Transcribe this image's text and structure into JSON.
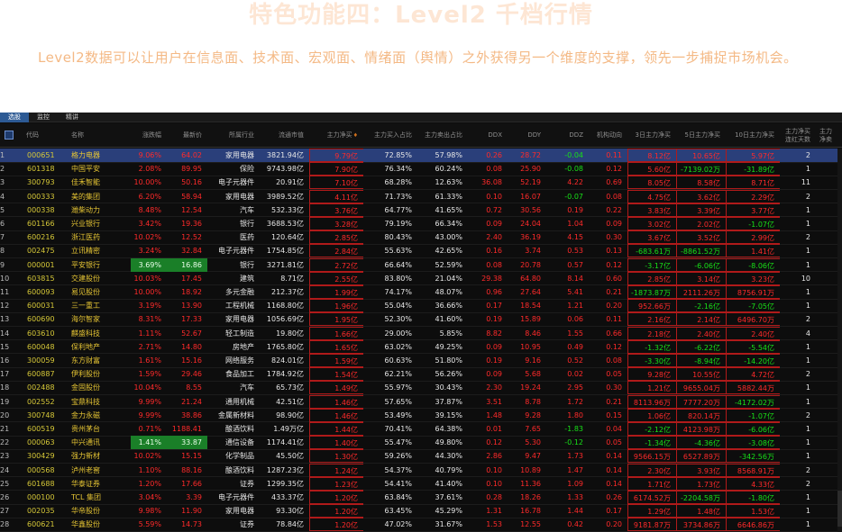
{
  "hero": {
    "title": "特色功能四：Level2 千档行情",
    "description": "Level2数据可以让用户在信息面、技术面、宏观面、情绪面（舆情）之外获得另一个维度的支撑，领先一步捕捉市场机会。"
  },
  "tabs": [
    "选股",
    "监控",
    "精讲"
  ],
  "columns": [
    "代码",
    "名称",
    "涨跌幅",
    "最新价",
    "所属行业",
    "流通市值",
    "主力净买",
    "主力买入占比",
    "主力卖出占比",
    "DDX",
    "DDY",
    "DDZ",
    "机构动向",
    "3日主力净买",
    "5日主力净买",
    "10日主力净买",
    "主力净买连红天数",
    "主力净卖"
  ],
  "colors": {
    "up": "#ff2a2a",
    "down": "#18e018",
    "selected": "#2a3f7a",
    "code": "#d6c838"
  },
  "rows": [
    {
      "idx": "1",
      "code": "000651",
      "name": "格力电器",
      "chg": "9.06%",
      "price": "64.02",
      "industry": "家用电器",
      "mcap": "3821.94亿",
      "net": "9.79亿",
      "buy": "72.85%",
      "sell": "57.98%",
      "ddx": "0.26",
      "ddy": "28.72",
      "ddz": "-0.04",
      "inst": "0.11",
      "d3": "8.12亿",
      "d5": "10.65亿",
      "d10": "5.97亿",
      "days": "2"
    },
    {
      "idx": "2",
      "code": "601318",
      "name": "中国平安",
      "chg": "2.08%",
      "price": "89.95",
      "industry": "保险",
      "mcap": "9743.98亿",
      "net": "7.90亿",
      "buy": "76.34%",
      "sell": "60.24%",
      "ddx": "0.08",
      "ddy": "25.90",
      "ddz": "-0.08",
      "inst": "0.12",
      "d3": "5.60亿",
      "d5": "-7139.02万",
      "d10": "-31.89亿",
      "days": "1"
    },
    {
      "idx": "3",
      "code": "300793",
      "name": "佳禾智能",
      "chg": "10.00%",
      "price": "50.16",
      "industry": "电子元器件",
      "mcap": "20.91亿",
      "net": "7.10亿",
      "buy": "68.28%",
      "sell": "12.63%",
      "ddx": "36.08",
      "ddy": "52.19",
      "ddz": "4.22",
      "inst": "0.69",
      "d3": "8.05亿",
      "d5": "8.58亿",
      "d10": "8.71亿",
      "days": "11"
    },
    {
      "idx": "4",
      "code": "000333",
      "name": "美的集团",
      "chg": "6.20%",
      "price": "58.94",
      "industry": "家用电器",
      "mcap": "3989.52亿",
      "net": "4.11亿",
      "buy": "71.73%",
      "sell": "61.33%",
      "ddx": "0.10",
      "ddy": "16.07",
      "ddz": "-0.07",
      "inst": "0.08",
      "d3": "4.75亿",
      "d5": "3.62亿",
      "d10": "2.29亿",
      "days": "2"
    },
    {
      "idx": "5",
      "code": "000338",
      "name": "潍柴动力",
      "chg": "8.48%",
      "price": "12.54",
      "industry": "汽车",
      "mcap": "532.33亿",
      "net": "3.76亿",
      "buy": "64.77%",
      "sell": "41.65%",
      "ddx": "0.72",
      "ddy": "30.56",
      "ddz": "0.19",
      "inst": "0.22",
      "d3": "3.83亿",
      "d5": "3.39亿",
      "d10": "3.77亿",
      "days": "1"
    },
    {
      "idx": "6",
      "code": "601166",
      "name": "兴业银行",
      "chg": "3.42%",
      "price": "19.36",
      "industry": "银行",
      "mcap": "3688.53亿",
      "net": "3.28亿",
      "buy": "79.19%",
      "sell": "66.34%",
      "ddx": "0.09",
      "ddy": "24.04",
      "ddz": "1.04",
      "inst": "0.09",
      "d3": "3.02亿",
      "d5": "2.02亿",
      "d10": "-1.07亿",
      "days": "1"
    },
    {
      "idx": "7",
      "code": "600216",
      "name": "浙江医药",
      "chg": "10.02%",
      "price": "12.52",
      "industry": "医药",
      "mcap": "120.64亿",
      "net": "2.85亿",
      "buy": "80.43%",
      "sell": "43.00%",
      "ddx": "2.40",
      "ddy": "36.19",
      "ddz": "4.15",
      "inst": "0.30",
      "d3": "3.67亿",
      "d5": "3.52亿",
      "d10": "2.99亿",
      "days": "2"
    },
    {
      "idx": "8",
      "code": "002475",
      "name": "立讯精密",
      "chg": "3.24%",
      "price": "32.84",
      "industry": "电子元器件",
      "mcap": "1754.85亿",
      "net": "2.84亿",
      "buy": "55.63%",
      "sell": "42.65%",
      "ddx": "0.16",
      "ddy": "3.74",
      "ddz": "0.53",
      "inst": "0.13",
      "d3": "-683.61万",
      "d5": "-8861.52万",
      "d10": "1.41亿",
      "days": "1"
    },
    {
      "idx": "9",
      "code": "000001",
      "name": "平安银行",
      "chg": "3.69%",
      "price": "16.86",
      "industry": "银行",
      "mcap": "3271.81亿",
      "net": "2.72亿",
      "buy": "66.64%",
      "sell": "52.59%",
      "ddx": "0.08",
      "ddy": "20.78",
      "ddz": "0.57",
      "inst": "0.12",
      "d3": "-3.17亿",
      "d5": "-6.06亿",
      "d10": "-8.06亿",
      "days": "1"
    },
    {
      "idx": "10",
      "code": "603815",
      "name": "交建股份",
      "chg": "10.03%",
      "price": "17.45",
      "industry": "建筑",
      "mcap": "8.71亿",
      "net": "2.55亿",
      "buy": "83.80%",
      "sell": "21.04%",
      "ddx": "29.38",
      "ddy": "64.80",
      "ddz": "8.14",
      "inst": "0.60",
      "d3": "2.85亿",
      "d5": "3.14亿",
      "d10": "3.23亿",
      "days": "10"
    },
    {
      "idx": "11",
      "code": "600093",
      "name": "易见股份",
      "chg": "10.00%",
      "price": "18.92",
      "industry": "多元金融",
      "mcap": "212.37亿",
      "net": "1.99亿",
      "buy": "74.17%",
      "sell": "48.07%",
      "ddx": "0.96",
      "ddy": "27.64",
      "ddz": "5.41",
      "inst": "0.21",
      "d3": "-1873.87万",
      "d5": "2111.26万",
      "d10": "8756.91万",
      "days": "1"
    },
    {
      "idx": "12",
      "code": "600031",
      "name": "三一重工",
      "chg": "3.19%",
      "price": "13.90",
      "industry": "工程机械",
      "mcap": "1168.80亿",
      "net": "1.96亿",
      "buy": "55.04%",
      "sell": "36.66%",
      "ddx": "0.17",
      "ddy": "18.54",
      "ddz": "1.21",
      "inst": "0.20",
      "d3": "952.66万",
      "d5": "-2.16亿",
      "d10": "-7.05亿",
      "days": "1"
    },
    {
      "idx": "13",
      "code": "600690",
      "name": "海尔智家",
      "chg": "8.31%",
      "price": "17.33",
      "industry": "家用电器",
      "mcap": "1056.69亿",
      "net": "1.95亿",
      "buy": "52.30%",
      "sell": "41.60%",
      "ddx": "0.19",
      "ddy": "15.89",
      "ddz": "0.06",
      "inst": "0.11",
      "d3": "2.16亿",
      "d5": "2.14亿",
      "d10": "6496.70万",
      "days": "2"
    },
    {
      "idx": "14",
      "code": "603610",
      "name": "麒盛科技",
      "chg": "1.11%",
      "price": "52.67",
      "industry": "轻工制造",
      "mcap": "19.80亿",
      "net": "1.66亿",
      "buy": "29.00%",
      "sell": "5.85%",
      "ddx": "8.82",
      "ddy": "8.46",
      "ddz": "1.55",
      "inst": "0.66",
      "d3": "2.18亿",
      "d5": "2.40亿",
      "d10": "2.40亿",
      "days": "4"
    },
    {
      "idx": "15",
      "code": "600048",
      "name": "保利地产",
      "chg": "2.71%",
      "price": "14.80",
      "industry": "房地产",
      "mcap": "1765.80亿",
      "net": "1.65亿",
      "buy": "63.02%",
      "sell": "49.25%",
      "ddx": "0.09",
      "ddy": "10.95",
      "ddz": "0.49",
      "inst": "0.12",
      "d3": "-1.32亿",
      "d5": "-6.22亿",
      "d10": "-5.54亿",
      "days": "1"
    },
    {
      "idx": "16",
      "code": "300059",
      "name": "东方财富",
      "chg": "1.61%",
      "price": "15.16",
      "industry": "网络服务",
      "mcap": "824.01亿",
      "net": "1.59亿",
      "buy": "60.63%",
      "sell": "51.80%",
      "ddx": "0.19",
      "ddy": "9.16",
      "ddz": "0.52",
      "inst": "0.08",
      "d3": "-3.30亿",
      "d5": "-8.94亿",
      "d10": "-14.20亿",
      "days": "1"
    },
    {
      "idx": "17",
      "code": "600887",
      "name": "伊利股份",
      "chg": "1.59%",
      "price": "29.46",
      "industry": "食品加工",
      "mcap": "1784.92亿",
      "net": "1.54亿",
      "buy": "62.21%",
      "sell": "56.26%",
      "ddx": "0.09",
      "ddy": "5.68",
      "ddz": "0.02",
      "inst": "0.05",
      "d3": "9.28亿",
      "d5": "10.55亿",
      "d10": "4.72亿",
      "days": "2"
    },
    {
      "idx": "18",
      "code": "002488",
      "name": "金固股份",
      "chg": "10.04%",
      "price": "8.55",
      "industry": "汽车",
      "mcap": "65.73亿",
      "net": "1.49亿",
      "buy": "55.97%",
      "sell": "30.43%",
      "ddx": "2.30",
      "ddy": "19.24",
      "ddz": "2.95",
      "inst": "0.30",
      "d3": "1.21亿",
      "d5": "9655.04万",
      "d10": "5882.44万",
      "days": "1"
    },
    {
      "idx": "19",
      "code": "002552",
      "name": "宝鼎科技",
      "chg": "9.99%",
      "price": "21.24",
      "industry": "通用机械",
      "mcap": "42.51亿",
      "net": "1.46亿",
      "buy": "57.65%",
      "sell": "37.87%",
      "ddx": "3.51",
      "ddy": "8.78",
      "ddz": "1.72",
      "inst": "0.21",
      "d3": "8113.96万",
      "d5": "7777.20万",
      "d10": "-4172.02万",
      "days": "1"
    },
    {
      "idx": "20",
      "code": "300748",
      "name": "金力永磁",
      "chg": "9.99%",
      "price": "38.86",
      "industry": "金属新材料",
      "mcap": "98.90亿",
      "net": "1.46亿",
      "buy": "53.49%",
      "sell": "39.15%",
      "ddx": "1.48",
      "ddy": "9.28",
      "ddz": "1.80",
      "inst": "0.15",
      "d3": "1.06亿",
      "d5": "820.14万",
      "d10": "-1.07亿",
      "days": "2"
    },
    {
      "idx": "21",
      "code": "600519",
      "name": "贵州茅台",
      "chg": "0.71%",
      "price": "1188.41",
      "industry": "酿酒饮料",
      "mcap": "1.49万亿",
      "net": "1.44亿",
      "buy": "70.41%",
      "sell": "64.38%",
      "ddx": "0.01",
      "ddy": "7.65",
      "ddz": "-1.83",
      "inst": "0.04",
      "d3": "-2.12亿",
      "d5": "4123.98万",
      "d10": "-6.06亿",
      "days": "1"
    },
    {
      "idx": "22",
      "code": "000063",
      "name": "中兴通讯",
      "chg": "1.41%",
      "price": "33.87",
      "industry": "通信设备",
      "mcap": "1174.41亿",
      "net": "1.40亿",
      "buy": "55.47%",
      "sell": "49.80%",
      "ddx": "0.12",
      "ddy": "5.30",
      "ddz": "-0.12",
      "inst": "0.05",
      "d3": "-1.34亿",
      "d5": "-4.36亿",
      "d10": "-3.08亿",
      "days": "1"
    },
    {
      "idx": "23",
      "code": "300429",
      "name": "强力新材",
      "chg": "10.02%",
      "price": "15.15",
      "industry": "化学制品",
      "mcap": "45.50亿",
      "net": "1.30亿",
      "buy": "59.26%",
      "sell": "44.30%",
      "ddx": "2.86",
      "ddy": "9.47",
      "ddz": "1.73",
      "inst": "0.14",
      "d3": "9566.15万",
      "d5": "6527.89万",
      "d10": "-342.56万",
      "days": "1"
    },
    {
      "idx": "24",
      "code": "000568",
      "name": "泸州老窖",
      "chg": "1.10%",
      "price": "88.16",
      "industry": "酿酒饮料",
      "mcap": "1287.23亿",
      "net": "1.24亿",
      "buy": "54.37%",
      "sell": "40.79%",
      "ddx": "0.10",
      "ddy": "10.89",
      "ddz": "1.47",
      "inst": "0.14",
      "d3": "2.30亿",
      "d5": "3.93亿",
      "d10": "8568.91万",
      "days": "2"
    },
    {
      "idx": "25",
      "code": "601688",
      "name": "华泰证券",
      "chg": "1.20%",
      "price": "17.66",
      "industry": "证券",
      "mcap": "1299.35亿",
      "net": "1.23亿",
      "buy": "54.41%",
      "sell": "41.40%",
      "ddx": "0.10",
      "ddy": "11.36",
      "ddz": "1.09",
      "inst": "0.14",
      "d3": "1.71亿",
      "d5": "1.73亿",
      "d10": "4.33亿",
      "days": "2"
    },
    {
      "idx": "26",
      "code": "000100",
      "name": "TCL 集团",
      "chg": "3.04%",
      "price": "3.39",
      "industry": "电子元器件",
      "mcap": "433.37亿",
      "net": "1.20亿",
      "buy": "63.84%",
      "sell": "37.61%",
      "ddx": "0.28",
      "ddy": "18.26",
      "ddz": "1.33",
      "inst": "0.26",
      "d3": "6174.52万",
      "d5": "-2204.58万",
      "d10": "-1.80亿",
      "days": "1"
    },
    {
      "idx": "27",
      "code": "002035",
      "name": "华帝股份",
      "chg": "9.98%",
      "price": "11.90",
      "industry": "家用电器",
      "mcap": "93.30亿",
      "net": "1.20亿",
      "buy": "63.45%",
      "sell": "45.29%",
      "ddx": "1.31",
      "ddy": "16.78",
      "ddz": "1.44",
      "inst": "0.17",
      "d3": "1.29亿",
      "d5": "1.48亿",
      "d10": "1.53亿",
      "days": "1"
    },
    {
      "idx": "28",
      "code": "600621",
      "name": "华鑫股份",
      "chg": "5.59%",
      "price": "14.73",
      "industry": "证券",
      "mcap": "78.84亿",
      "net": "1.20亿",
      "buy": "47.02%",
      "sell": "31.67%",
      "ddx": "1.53",
      "ddy": "12.55",
      "ddz": "0.42",
      "inst": "0.20",
      "d3": "9181.87万",
      "d5": "3734.86万",
      "d10": "6646.86万",
      "days": "1"
    }
  ]
}
